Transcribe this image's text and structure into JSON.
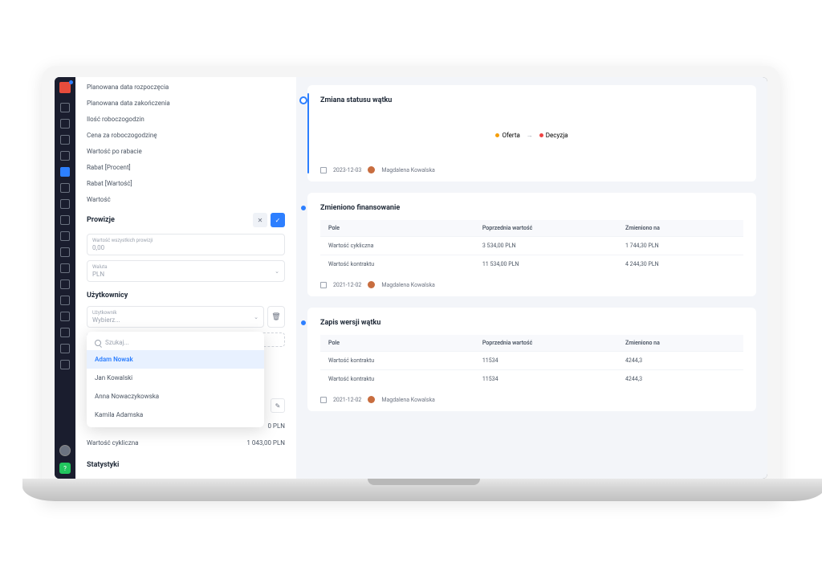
{
  "left": {
    "fields": [
      "Planowana data rozpoczęcia",
      "Planowana data zakończenia",
      "Ilość roboczogodzin",
      "Cena za roboczogodzinę",
      "Wartość po rabacie",
      "Rabat [Procent]",
      "Rabat [Wartość]",
      "Wartość"
    ],
    "commissions": {
      "title": "Prowizje",
      "total_label": "Wartość wszystkich prowizji",
      "total_value": "0,00",
      "currency_label": "Waluta",
      "currency_value": "PLN"
    },
    "users": {
      "title": "Użytkownicy",
      "label": "Użytkownik",
      "placeholder": "Wybierz...",
      "search_placeholder": "Szukaj...",
      "options": [
        "Adam Nowak",
        "Jan Kowalski",
        "Anna Nowaczykowska",
        "Kamila Adamska"
      ]
    },
    "values": {
      "row1_amount": "0 PLN",
      "cyclic_label": "Wartość cykliczna",
      "cyclic_amount": "1 043,00 PLN"
    },
    "stats_title": "Statystyki"
  },
  "timeline": {
    "card1": {
      "title": "Zmiana statusu wątku",
      "status_from": "Oferta",
      "status_to": "Decyzja",
      "date": "2023-12-03",
      "author": "Magdalena Kowalska"
    },
    "card2": {
      "title": "Zmieniono finansowanie",
      "headers": {
        "c1": "Pole",
        "c2": "Poprzednia wartość",
        "c3": "Zmieniono na"
      },
      "rows": [
        {
          "c1": "Wartość cykliczna",
          "c2": "3 534,00 PLN",
          "c3": "1 744,30 PLN"
        },
        {
          "c1": "Wartość kontraktu",
          "c2": "11 534,00 PLN",
          "c3": "4 244,30 PLN"
        }
      ],
      "date": "2021-12-02",
      "author": "Magdalena Kowalska"
    },
    "card3": {
      "title": "Zapis wersji wątku",
      "headers": {
        "c1": "Pole",
        "c2": "Poprzednia wartość",
        "c3": "Zmieniono na"
      },
      "rows": [
        {
          "c1": "Wartość kontraktu",
          "c2": "11534",
          "c3": "4244,3"
        },
        {
          "c1": "Wartość kontraktu",
          "c2": "11534",
          "c3": "4244,3"
        }
      ],
      "date": "2021-12-02",
      "author": "Magdalena Kowalska"
    }
  }
}
